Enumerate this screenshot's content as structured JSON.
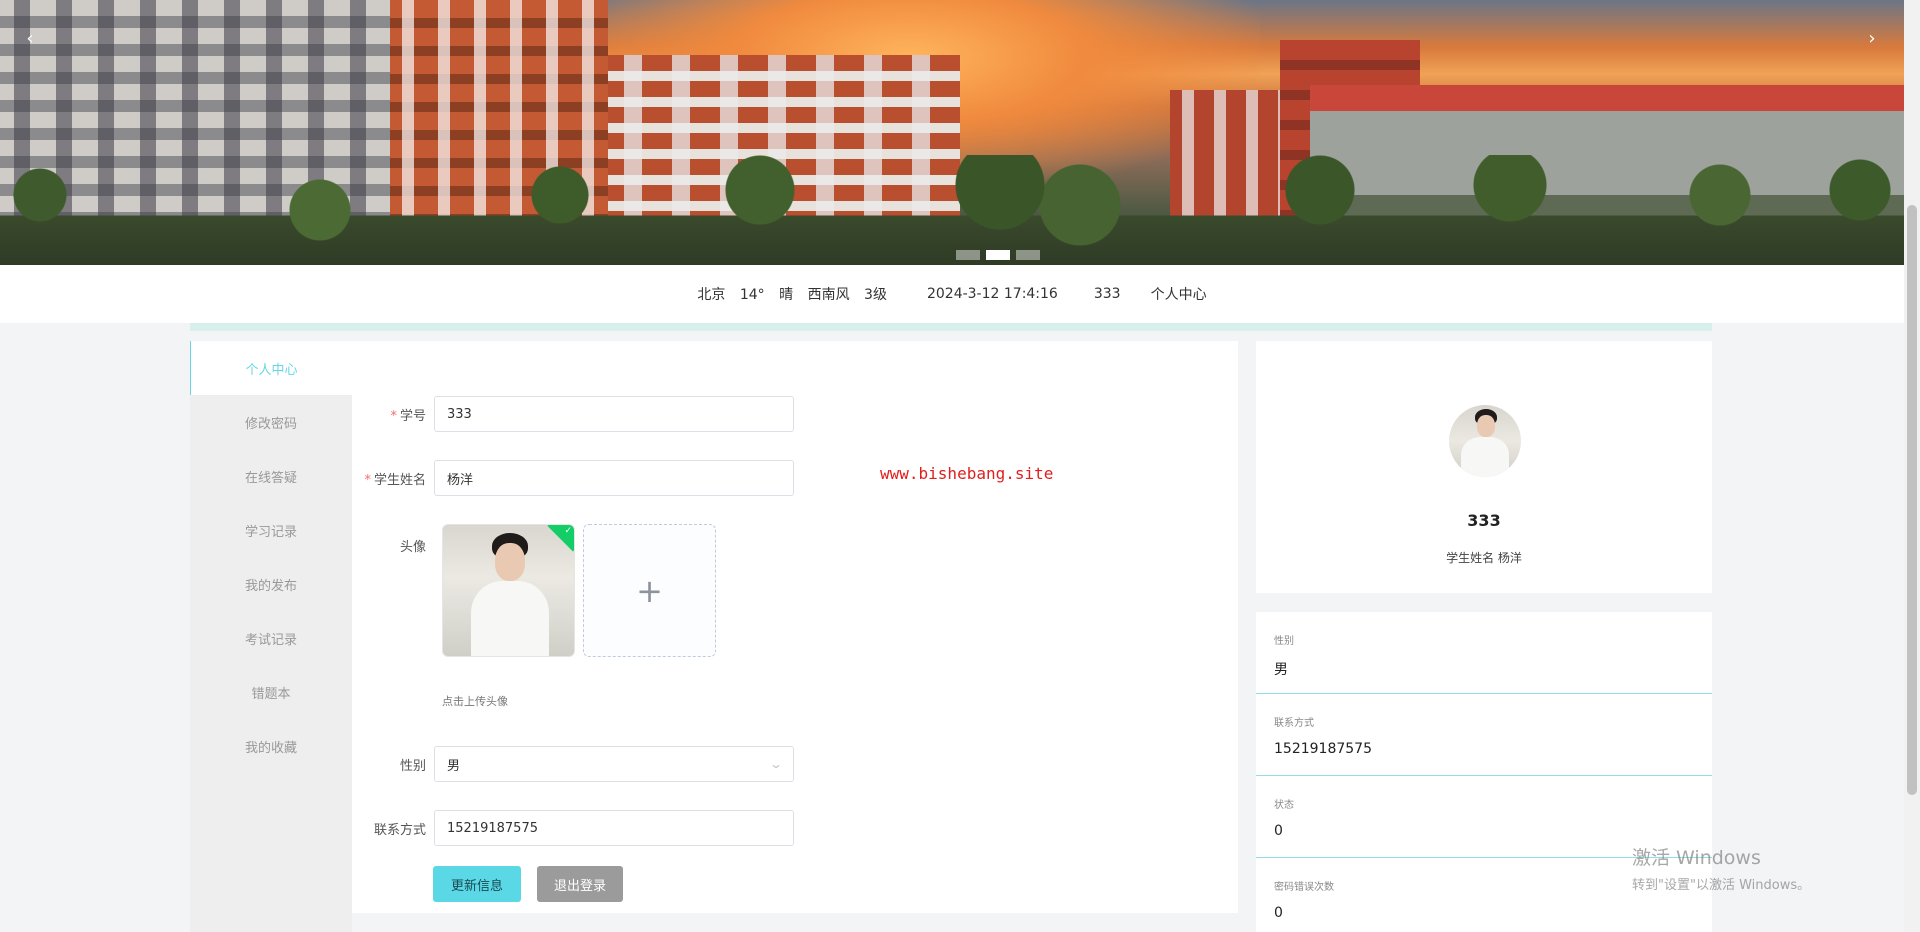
{
  "banner": {
    "prev_icon": "chevron-left",
    "next_icon": "chevron-right",
    "prev_glyph": "‹",
    "next_glyph": "›",
    "slide_count": 3,
    "active_slide": 2
  },
  "infobar": {
    "city": "北京",
    "temp": "14°",
    "weather": "晴",
    "wind": "西南风",
    "wind_level": "3级",
    "datetime": "2024-3-12 17:4:16",
    "user": "333",
    "center_link": "个人中心"
  },
  "sidebar": {
    "items": [
      {
        "label": "个人中心",
        "active": true
      },
      {
        "label": "修改密码"
      },
      {
        "label": "在线答疑"
      },
      {
        "label": "学习记录"
      },
      {
        "label": "我的发布"
      },
      {
        "label": "考试记录"
      },
      {
        "label": "错题本"
      },
      {
        "label": "我的收藏"
      }
    ]
  },
  "form": {
    "student_no_label": "学号",
    "student_no_value": "333",
    "name_label": "学生姓名",
    "name_value": "杨洋",
    "avatar_label": "头像",
    "upload_icon": "plus",
    "upload_glyph": "+",
    "upload_tip": "点击上传头像",
    "gender_label": "性别",
    "gender_value": "男",
    "contact_label": "联系方式",
    "contact_value": "15219187575",
    "update_button": "更新信息",
    "logout_button": "退出登录",
    "required_mark": "*",
    "check_glyph": "✓"
  },
  "watermark_url": "www.bishebang.site",
  "profile": {
    "name": "333",
    "sub_label": "学生姓名",
    "sub_value": "杨洋"
  },
  "details": [
    {
      "label": "性别",
      "value": "男"
    },
    {
      "label": "联系方式",
      "value": "15219187575"
    },
    {
      "label": "状态",
      "value": "0"
    },
    {
      "label": "密码错误次数",
      "value": "0"
    }
  ],
  "windows_activation": {
    "title": "激活 Windows",
    "subtitle": "转到\"设置\"以激活 Windows。"
  },
  "colors": {
    "accent": "#5ad8e6",
    "required": "#f56c6c",
    "success": "#13ce66",
    "watermark": "#e01e1e"
  }
}
